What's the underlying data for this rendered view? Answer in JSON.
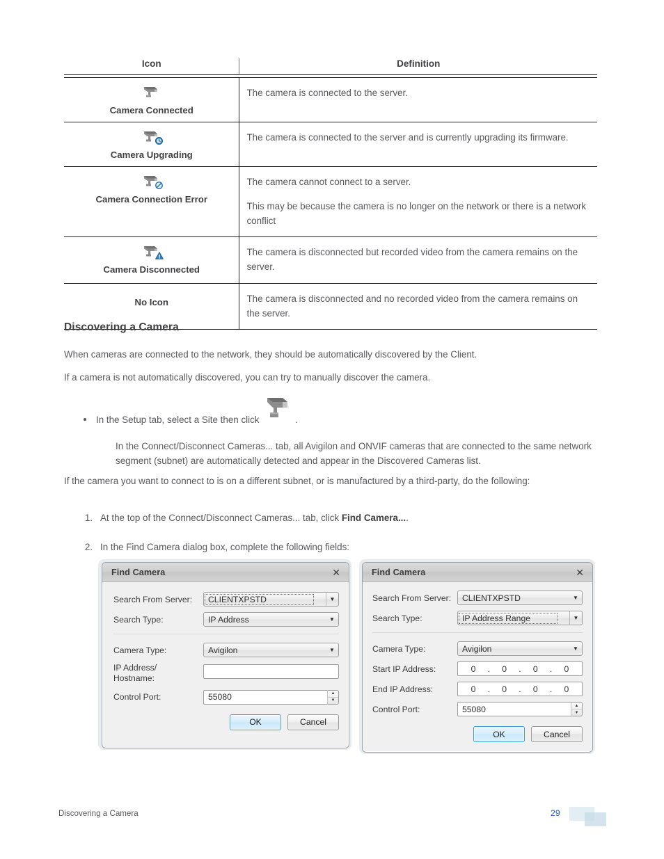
{
  "table": {
    "headers": [
      "Icon",
      "Definition"
    ],
    "rows": [
      {
        "icon": "camera-connected-icon",
        "label": "Camera Connected",
        "paragraphs": [
          "The camera is connected to the server."
        ]
      },
      {
        "icon": "camera-upgrading-icon",
        "label": "Camera Upgrading",
        "paragraphs": [
          "The camera is connected to the server and is currently upgrading its firmware."
        ]
      },
      {
        "icon": "camera-connection-error-icon",
        "label": "Camera Connection Error",
        "paragraphs": [
          "The camera cannot connect to a server.",
          "This may be because the camera is no longer on the network or there is a network conflict"
        ]
      },
      {
        "icon": "camera-disconnected-icon",
        "label": "Camera Disconnected",
        "paragraphs": [
          "The camera is disconnected but recorded video from the camera remains on the server."
        ]
      },
      {
        "icon": "none",
        "label": "No Icon",
        "paragraphs": [
          "The camera is disconnected and no recorded video from the camera remains on the server."
        ]
      }
    ]
  },
  "section": {
    "title": "Discovering a Camera",
    "p1": "When cameras are connected to the network, they should be automatically discovered by the Client.",
    "p2": "If a camera is not automatically discovered, you can try to manually discover the camera.",
    "bullet_before": "In the Setup tab, select a Site then click",
    "bullet_after": ".",
    "bullet_sub": "In the Connect/Disconnect Cameras... tab, all Avigilon and ONVIF cameras that are connected to the same network segment (subnet) are automatically detected and appear in the Discovered Cameras list.",
    "p3": "If the camera you want to connect to is on a different subnet, or is manufactured by a third-party, do the following:",
    "steps": [
      {
        "num": "1.",
        "text_before": "At the top of the Connect/Disconnect Cameras... tab, click ",
        "bold": "Find Camera...",
        "text_after": "."
      },
      {
        "num": "2.",
        "text_before": "In the Find Camera dialog box, complete the following fields:",
        "bold": "",
        "text_after": ""
      }
    ]
  },
  "dialog_left": {
    "title": "Find Camera",
    "close": "✕",
    "fields": {
      "search_from_server_label": "Search From Server:",
      "search_from_server_value": "CLIENTXPSTD",
      "search_type_label": "Search Type:",
      "search_type_value": "IP Address",
      "camera_type_label": "Camera Type:",
      "camera_type_value": "Avigilon",
      "ip_hostname_label_line1": "IP Address/",
      "ip_hostname_label_line2": "Hostname:",
      "ip_hostname_value": "",
      "control_port_label": "Control Port:",
      "control_port_value": "55080"
    },
    "ok": "OK",
    "cancel": "Cancel"
  },
  "dialog_right": {
    "title": "Find Camera",
    "close": "✕",
    "fields": {
      "search_from_server_label": "Search From Server:",
      "search_from_server_value": "CLIENTXPSTD",
      "search_type_label": "Search Type:",
      "search_type_value": "IP Address Range",
      "camera_type_label": "Camera Type:",
      "camera_type_value": "Avigilon",
      "start_ip_label": "Start IP Address:",
      "start_ip_octets": [
        "0",
        "0",
        "0",
        "0"
      ],
      "end_ip_label": "End IP Address:",
      "end_ip_octets": [
        "0",
        "0",
        "0",
        "0"
      ],
      "control_port_label": "Control Port:",
      "control_port_value": "55080"
    },
    "ok": "OK",
    "cancel": "Cancel"
  },
  "footer": {
    "left": "Discovering a Camera",
    "page": "29"
  },
  "colors": {
    "body_text": "#58585b",
    "heading_text": "#414042",
    "page_number": "#1f5fd0",
    "badge_blue": "#1f72b8",
    "default_button_border": "#3c9fd4"
  }
}
